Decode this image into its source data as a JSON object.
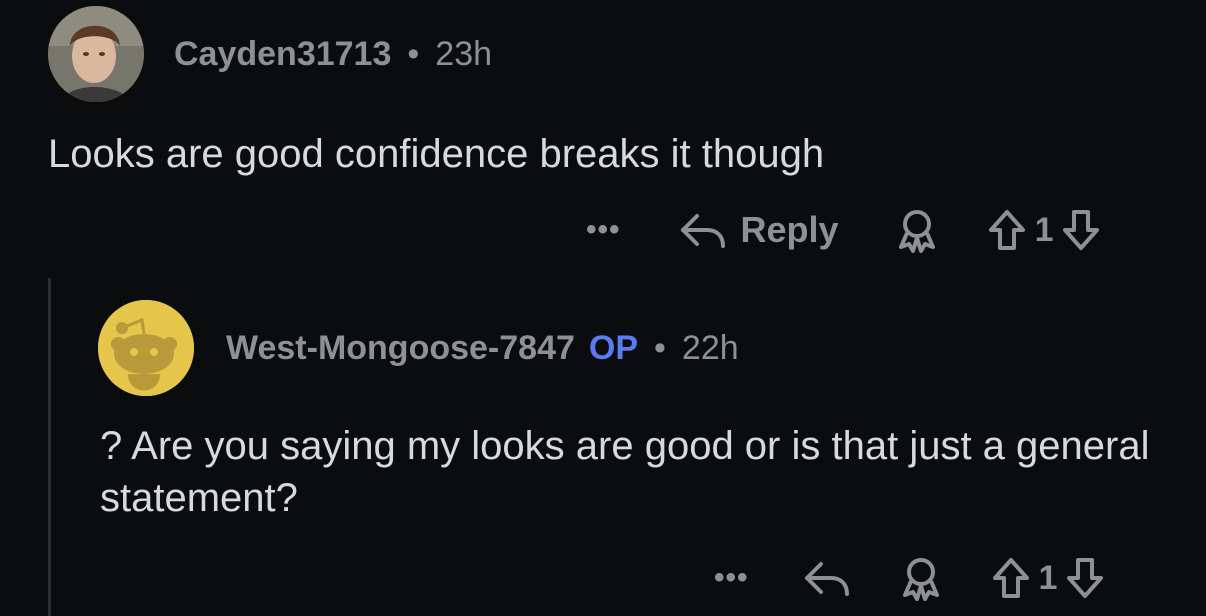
{
  "comments": [
    {
      "username": "Cayden31713",
      "separator": "•",
      "time": "23h",
      "text": "Looks are good confidence breaks it though",
      "more": "•••",
      "reply_label": "Reply",
      "vote_count": "1"
    },
    {
      "username": "West-Mongoose-7847",
      "badge": "OP",
      "separator": "•",
      "time": "22h",
      "text": "? Are you saying my looks are good or is that just a general statement?",
      "more": "•••",
      "vote_count": "1"
    }
  ],
  "colors": {
    "background": "#0b0c0e",
    "text": "#d7dadc",
    "muted": "#8c9196",
    "op_badge": "#5b7cf0",
    "avatar_yellow": "#e5c64b"
  }
}
